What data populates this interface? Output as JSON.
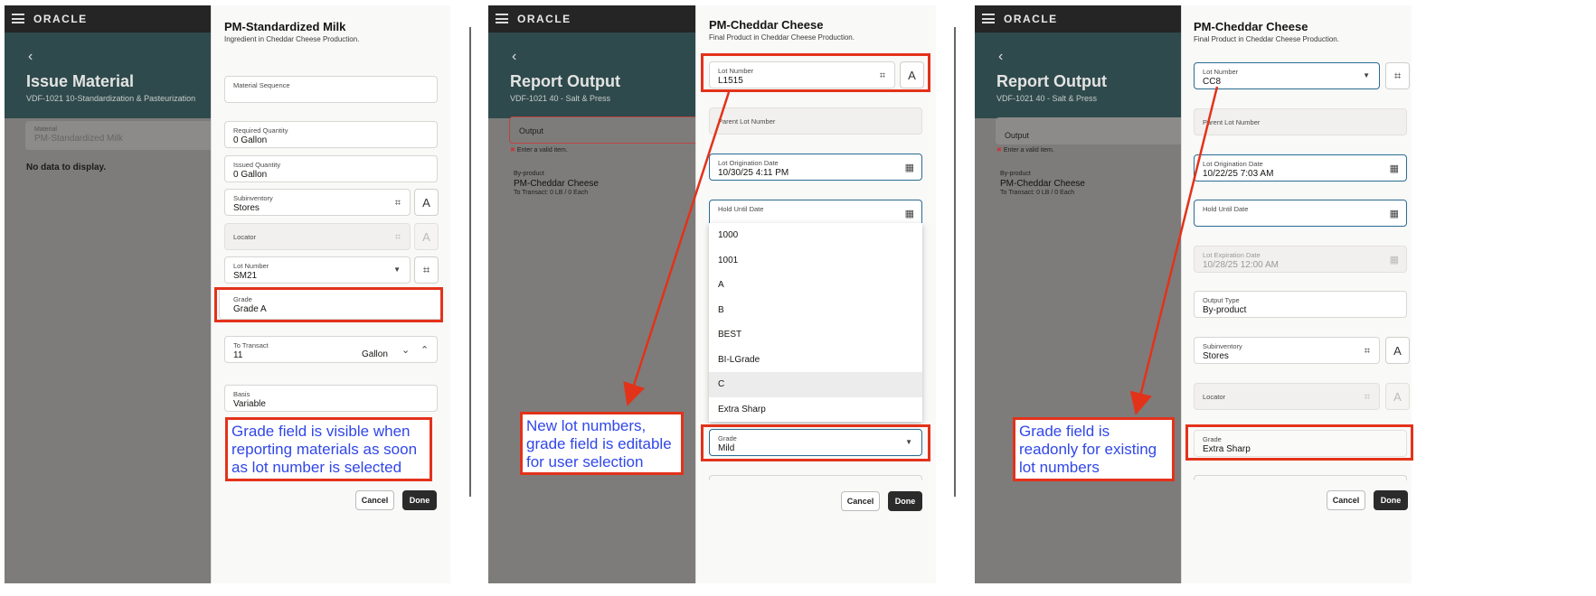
{
  "brand": "ORACLE",
  "screen1": {
    "page_title": "Issue Material",
    "page_subtitle": "VDF-1021 10-Standardization & Pasteurization",
    "material_label": "Material",
    "material_value": "PM-Standardized Milk",
    "empty_text": "No data to display.",
    "panel_title": "PM-Standardized Milk",
    "panel_subtitle": "Ingredient in Cheddar Cheese Production.",
    "fields": {
      "material_sequence": "Material Sequence",
      "required_qty_label": "Required Quantity",
      "required_qty_value": "0 Gallon",
      "issued_qty_label": "Issued Quantity",
      "issued_qty_value": "0 Gallon",
      "subinventory_label": "Subinventory",
      "subinventory_value": "Stores",
      "locator_label": "Locator",
      "lot_label": "Lot Number",
      "lot_value": "SM21",
      "grade_label": "Grade",
      "grade_value": "Grade A",
      "transact_label": "To Transact",
      "transact_value": "11",
      "transact_uom": "Gallon",
      "basis_label": "Basis",
      "basis_value": "Variable"
    },
    "note": "Grade field is visible when reporting materials as soon as lot number is selected",
    "cancel": "Cancel",
    "done": "Done"
  },
  "screen2": {
    "page_title": "Report Output",
    "page_subtitle": "VDF-1021 40 - Salt & Press",
    "output_label": "Output",
    "error_text": "Enter a valid item.",
    "byproduct_label": "By-product",
    "byproduct_name": "PM-Cheddar Cheese",
    "byproduct_transact": "To Transact: 0 LB / 0 Each",
    "panel_title": "PM-Cheddar Cheese",
    "panel_subtitle": "Final Product in Cheddar Cheese Production.",
    "fields": {
      "lot_label": "Lot Number",
      "lot_value": "L1515",
      "parent_lot_label": "Parent Lot Number",
      "origination_label": "Lot Origination Date",
      "origination_value": "10/30/25 4:11 PM",
      "hold_label": "Hold Until Date",
      "grade_label": "Grade",
      "grade_value": "Mild"
    },
    "grade_options": [
      "1000",
      "1001",
      "A",
      "B",
      "BEST",
      "BI-LGrade",
      "C",
      "Extra Sharp"
    ],
    "note": "New lot numbers, grade field is editable for user selection",
    "cancel": "Cancel",
    "done": "Done"
  },
  "screen3": {
    "page_title": "Report Output",
    "page_subtitle": "VDF-1021 40 - Salt & Press",
    "output_label": "Output",
    "error_text": "Enter a valid item.",
    "byproduct_label": "By-product",
    "byproduct_name": "PM-Cheddar Cheese",
    "byproduct_transact": "To Transact: 0 LB / 0 Each",
    "panel_title": "PM-Cheddar Cheese",
    "panel_subtitle": "Final Product in Cheddar Cheese Production.",
    "fields": {
      "lot_label": "Lot Number",
      "lot_value": "CC8",
      "parent_lot_label": "Parent Lot Number",
      "origination_label": "Lot Origination Date",
      "origination_value": "10/22/25 7:03 AM",
      "hold_label": "Hold Until Date",
      "expiration_label": "Lot Expiration Date",
      "expiration_value": "10/28/25 12:00 AM",
      "output_type_label": "Output Type",
      "output_type_value": "By-product",
      "subinventory_label": "Subinventory",
      "subinventory_value": "Stores",
      "locator_label": "Locator",
      "grade_label": "Grade",
      "grade_value": "Extra Sharp"
    },
    "note": "Grade field is readonly for existing lot numbers",
    "cancel": "Cancel",
    "done": "Done"
  },
  "colors": {
    "annotation_red": "#e3321a",
    "note_text": "#3047e8",
    "header_teal": "#2f4a4c"
  },
  "icons": {
    "menu": "hamburger-icon",
    "scan": "barcode-scan-icon",
    "text": "text-entry-icon",
    "calendar": "calendar-icon",
    "dropdown": "chevron-down-icon"
  }
}
